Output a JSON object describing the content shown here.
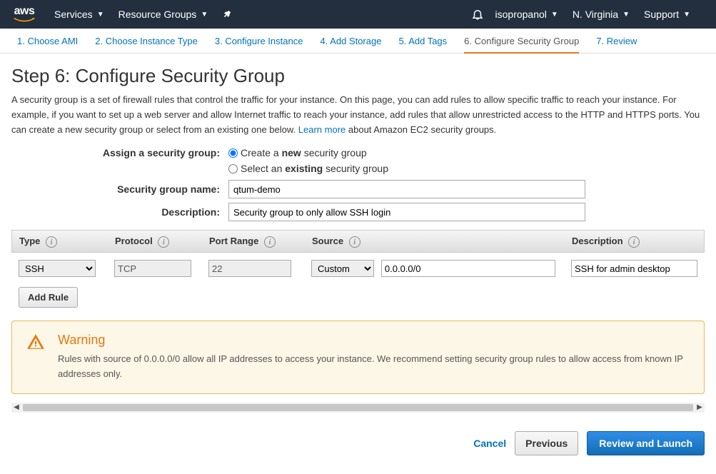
{
  "topnav": {
    "services": "Services",
    "resource_groups": "Resource Groups",
    "username": "isopropanol",
    "region": "N. Virginia",
    "support": "Support"
  },
  "tabs": [
    "1. Choose AMI",
    "2. Choose Instance Type",
    "3. Configure Instance",
    "4. Add Storage",
    "5. Add Tags",
    "6. Configure Security Group",
    "7. Review"
  ],
  "heading": "Step 6: Configure Security Group",
  "description_pre": "A security group is a set of firewall rules that control the traffic for your instance. On this page, you can add rules to allow specific traffic to reach your instance. For example, if you want to set up a web server and allow Internet traffic to reach your instance, add rules that allow unrestricted access to the HTTP and HTTPS ports. You can create a new security group or select from an existing one below. ",
  "learn_more": "Learn more",
  "description_post": " about Amazon EC2 security groups.",
  "form": {
    "assign_label": "Assign a security group:",
    "radio_create_pre": "Create a ",
    "radio_create_bold": "new",
    "radio_create_post": " security group",
    "radio_select_pre": "Select an ",
    "radio_select_bold": "existing",
    "radio_select_post": " security group",
    "name_label": "Security group name:",
    "name_value": "qtum-demo",
    "desc_label": "Description:",
    "desc_value": "Security group to only allow SSH login"
  },
  "table": {
    "headers": {
      "type": "Type",
      "protocol": "Protocol",
      "port": "Port Range",
      "source": "Source",
      "description": "Description"
    },
    "row": {
      "type": "SSH",
      "protocol": "TCP",
      "port": "22",
      "source_mode": "Custom",
      "source_cidr": "0.0.0.0/0",
      "description": "SSH for admin desktop"
    },
    "add_rule": "Add Rule"
  },
  "warning": {
    "title": "Warning",
    "text": "Rules with source of 0.0.0.0/0 allow all IP addresses to access your instance. We recommend setting security group rules to allow access from known IP addresses only."
  },
  "footer": {
    "cancel": "Cancel",
    "previous": "Previous",
    "launch": "Review and Launch"
  }
}
